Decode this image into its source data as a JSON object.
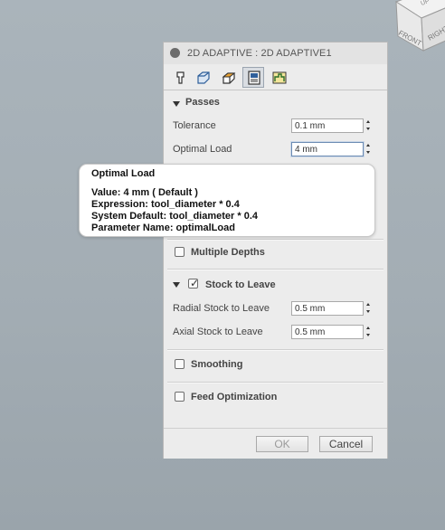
{
  "window": {
    "title": "2D ADAPTIVE : 2D ADAPTIVE1"
  },
  "viewcube": {
    "faces": [
      "FRONT",
      "RIGHT",
      "UP"
    ]
  },
  "tabs": [
    {
      "name": "tool",
      "icon": "tool-icon",
      "active": false
    },
    {
      "name": "geometry",
      "icon": "geometry-icon",
      "active": false
    },
    {
      "name": "heights",
      "icon": "heights-icon",
      "active": false
    },
    {
      "name": "passes",
      "icon": "passes-icon",
      "active": true
    },
    {
      "name": "linking",
      "icon": "linking-icon",
      "active": false
    }
  ],
  "passes": {
    "heading": "Passes",
    "tolerance_label": "Tolerance",
    "tolerance_value": "0.1 mm",
    "optimal_load_label": "Optimal Load",
    "optimal_load_value": "4 mm"
  },
  "tooltip": {
    "title": "Optimal Load",
    "value_line": "Value: 4 mm ( Default )",
    "expression_line": "Expression: tool_diameter * 0.4",
    "system_default_line": "System Default: tool_diameter * 0.4",
    "parameter_line": "Parameter Name: optimalLoad"
  },
  "multiple_depths": {
    "label": "Multiple Depths",
    "checked": false
  },
  "stock_to_leave": {
    "label": "Stock to Leave",
    "checked": true,
    "radial_label": "Radial Stock to Leave",
    "radial_value": "0.5 mm",
    "axial_label": "Axial Stock to Leave",
    "axial_value": "0.5 mm"
  },
  "smoothing": {
    "label": "Smoothing",
    "checked": false
  },
  "feed_optimization": {
    "label": "Feed Optimization",
    "checked": false
  },
  "buttons": {
    "ok": "OK",
    "cancel": "Cancel"
  },
  "colors": {
    "background": "#a3adb4",
    "panel": "#ececec",
    "accent": "#d9a920"
  }
}
